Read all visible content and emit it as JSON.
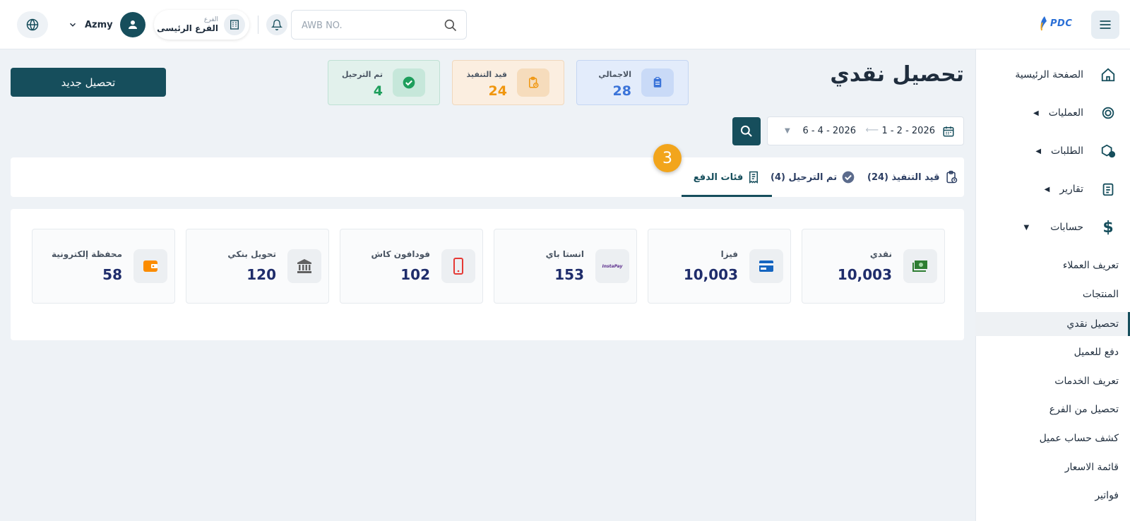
{
  "header": {
    "awb_placeholder": "AWB NO.",
    "branch_label": "الفرع",
    "branch_value": "الفرع الرئيسى",
    "username": "Azmy",
    "logo_text": "PDC"
  },
  "sidebar": {
    "items": [
      {
        "label": "الصفحة الرئيسية",
        "icon": "home-icon"
      },
      {
        "label": "العمليات",
        "icon": "operations-icon"
      },
      {
        "label": "الطلبات",
        "icon": "orders-icon"
      },
      {
        "label": "تقارير",
        "icon": "reports-icon"
      },
      {
        "label": "حسابات",
        "icon": "dollar-icon"
      }
    ],
    "subitems": [
      "تعريف العملاء",
      "المنتجات",
      "تحصيل نقدي",
      "دفع للعميل",
      "تعريف الخدمات",
      "تحصيل من الفرع",
      "كشف حساب عميل",
      "قائمة الاسعار",
      "فواتير"
    ],
    "active_subitem": "تحصيل نقدي"
  },
  "page": {
    "title": "تحصيل نقدي",
    "new_button": "تحصيل جديد"
  },
  "stats": {
    "total": {
      "label": "الاجمالي",
      "value": "28",
      "color": "#3b74d9"
    },
    "pending": {
      "label": "قيد التنفيذ",
      "value": "24",
      "color": "#f0960e"
    },
    "done": {
      "label": "تم الترحيل",
      "value": "4",
      "color": "#1e9e5c"
    }
  },
  "filter": {
    "date_from": "1 - 2 - 2026",
    "date_to": "6 - 4 - 2026"
  },
  "tabs": [
    {
      "label": "قيد التنفيذ (24)"
    },
    {
      "label": "تم الترحيل (4)"
    },
    {
      "label": "فئات الدفع"
    }
  ],
  "active_tab": "فئات الدفع",
  "step_badge": "3",
  "payment_methods": [
    {
      "label": "نقدي",
      "value": "10,003",
      "icon": "cash-icon"
    },
    {
      "label": "فيزا",
      "value": "10,003",
      "icon": "card-icon"
    },
    {
      "label": "انستا باي",
      "value": "153",
      "icon": "instapay-icon",
      "icon_text": "InstaPay"
    },
    {
      "label": "فودافون كاش",
      "value": "102",
      "icon": "mobile-icon"
    },
    {
      "label": "تحويل بنكي",
      "value": "120",
      "icon": "bank-icon"
    },
    {
      "label": "محفظة إلكترونية",
      "value": "58",
      "icon": "wallet-icon"
    }
  ],
  "colors": {
    "primary": "#164e5c",
    "accent_badge": "#f2a51c"
  }
}
